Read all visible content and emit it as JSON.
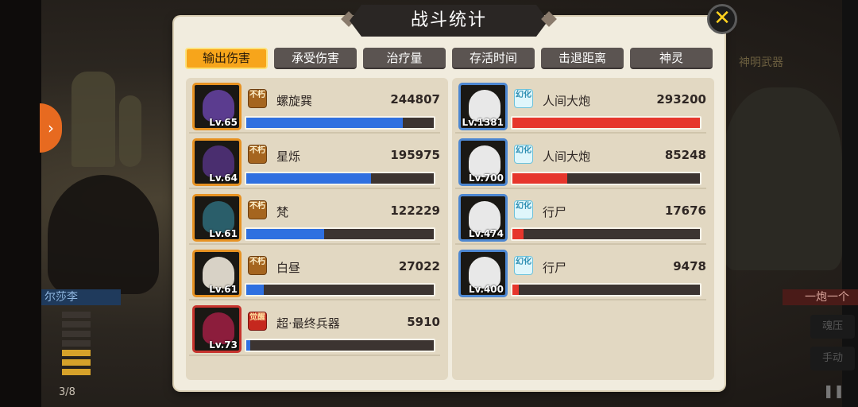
{
  "title": "战斗统计",
  "close_icon": "close-icon",
  "tabs": [
    {
      "label": "输出伤害",
      "active": true
    },
    {
      "label": "承受伤害",
      "active": false
    },
    {
      "label": "治疗量",
      "active": false
    },
    {
      "label": "存活时间",
      "active": false
    },
    {
      "label": "击退距离",
      "active": false
    },
    {
      "label": "神灵",
      "active": false
    }
  ],
  "left_team": [
    {
      "name": "螺旋巽",
      "value": "244807",
      "level": "Lv.65",
      "badge": "不朽",
      "badge_style": "gold",
      "fill": 0.834,
      "avatar_color": "#5b3c8f"
    },
    {
      "name": "星烁",
      "value": "195975",
      "level": "Lv.64",
      "badge": "不朽",
      "badge_style": "gold",
      "fill": 0.667,
      "avatar_color": "#4a2e6f"
    },
    {
      "name": "梵",
      "value": "122229",
      "level": "Lv.61",
      "badge": "不朽",
      "badge_style": "gold",
      "fill": 0.416,
      "avatar_color": "#2a5e6a"
    },
    {
      "name": "白昼",
      "value": "27022",
      "level": "Lv.61",
      "badge": "不朽",
      "badge_style": "gold",
      "fill": 0.092,
      "avatar_color": "#d8d2c6"
    },
    {
      "name": "超·最终兵器",
      "value": "5910",
      "level": "Lv.73",
      "badge": "觉醒",
      "badge_style": "red",
      "fill": 0.02,
      "avatar_color": "#8c1d3c"
    }
  ],
  "right_team": [
    {
      "name": "人间大炮",
      "value": "293200",
      "level": "Lv.1381",
      "badge": "幻化",
      "badge_style": "cyan",
      "fill": 1.0,
      "avatar_color": "#e8e8e8"
    },
    {
      "name": "人间大炮",
      "value": "85248",
      "level": "Lv.700",
      "badge": "幻化",
      "badge_style": "cyan",
      "fill": 0.291,
      "avatar_color": "#e8e8e8"
    },
    {
      "name": "行尸",
      "value": "17676",
      "level": "Lv.474",
      "badge": "幻化",
      "badge_style": "cyan",
      "fill": 0.06,
      "avatar_color": "#e8e8e8"
    },
    {
      "name": "行尸",
      "value": "9478",
      "level": "Lv.400",
      "badge": "幻化",
      "badge_style": "cyan",
      "fill": 0.032,
      "avatar_color": "#e8e8e8"
    }
  ],
  "background": {
    "left_name": "尔莎李",
    "right_name": "一炮一个",
    "energy": "3/8",
    "energy_filled": 3,
    "energy_total": 8,
    "right_label": "神明武器",
    "ctrl_1": "魂压",
    "ctrl_2": "手动"
  },
  "colors": {
    "active_tab": "#f7a51b",
    "ally_bar": "#2f70e0",
    "enemy_bar": "#e6362c",
    "panel_bg": "#f1ecde"
  }
}
